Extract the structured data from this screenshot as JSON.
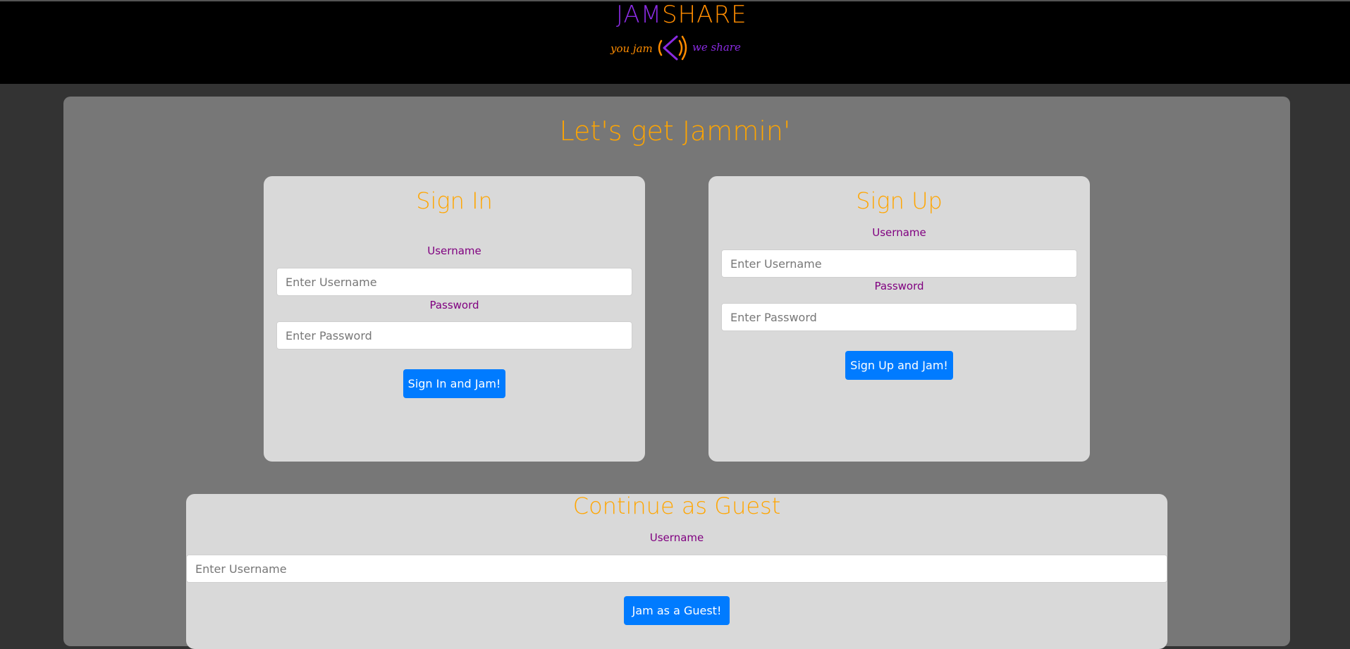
{
  "header": {
    "logo_jam": "JAM",
    "logo_share": "SHARE",
    "tagline_left": "you jam",
    "tagline_right": "we share",
    "icon": "megaphone-icon"
  },
  "main": {
    "title": "Let's get Jammin'"
  },
  "signin": {
    "title": "Sign In",
    "username_label": "Username",
    "username_placeholder": "Enter Username",
    "password_label": "Password",
    "password_placeholder": "Enter Password",
    "button": "Sign In and Jam!"
  },
  "signup": {
    "title": "Sign Up",
    "username_label": "Username",
    "username_placeholder": "Enter Username",
    "password_label": "Password",
    "password_placeholder": "Enter Password",
    "button": "Sign Up and Jam!"
  },
  "guest": {
    "title": "Continue as Guest",
    "username_label": "Username",
    "username_placeholder": "Enter Username",
    "button": "Jam as a Guest!"
  },
  "colors": {
    "accent_orange": "#ffa500",
    "accent_purple": "#800080",
    "button_blue": "#007bff",
    "logo_purple": "#8a2be2",
    "logo_orange": "#ff8c00"
  }
}
